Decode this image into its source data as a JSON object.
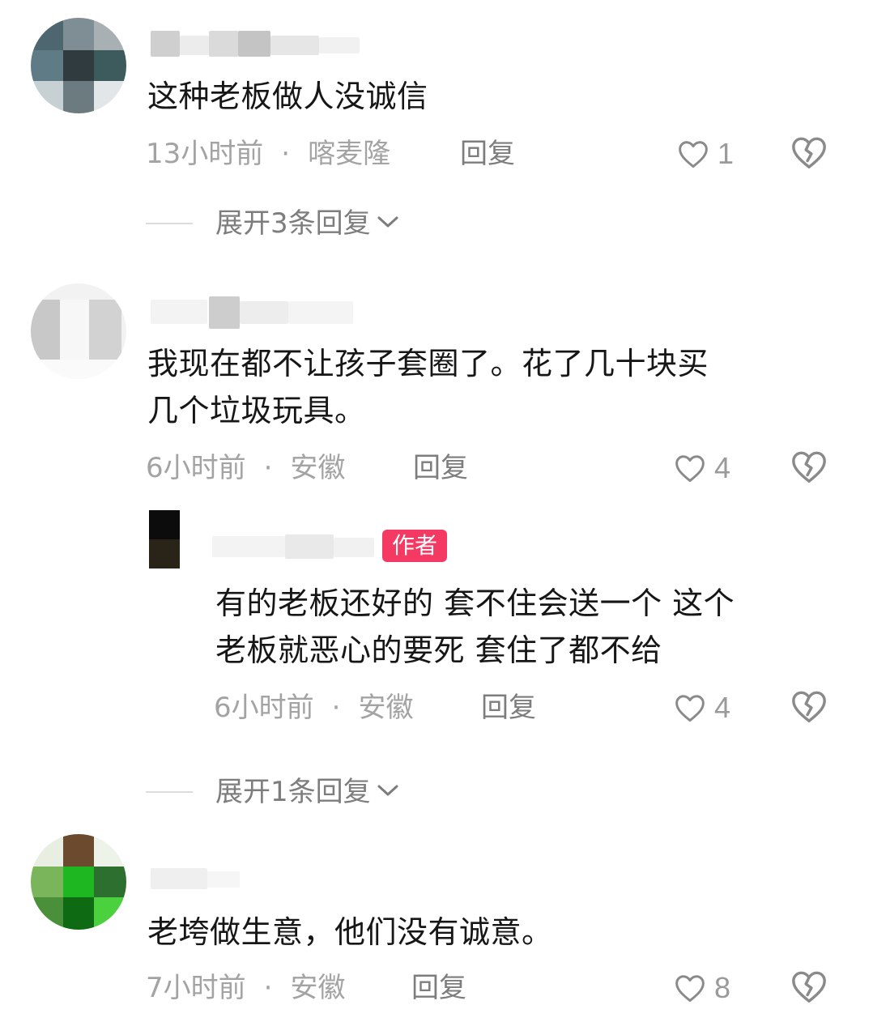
{
  "comments": [
    {
      "content_lines": [
        "这种老板做人没诚信"
      ],
      "time": "13小时前",
      "location": "喀麦隆",
      "reply_label": "回复",
      "likes": "1",
      "expand_label": "展开3条回复"
    },
    {
      "content_lines": [
        "我现在都不让孩子套圈了。花了几十块买",
        "几个垃圾玩具。"
      ],
      "time": "6小时前",
      "location": "安徽",
      "reply_label": "回复",
      "likes": "4",
      "reply": {
        "badge": "作者",
        "content_lines": [
          "有的老板还好的 套不住会送一个 这个",
          "老板就恶心的要死 套住了都不给"
        ],
        "time": "6小时前",
        "location": "安徽",
        "reply_label": "回复",
        "likes": "4"
      },
      "expand_label": "展开1条回复"
    },
    {
      "content_lines": [
        "老垮做生意，他们没有诚意。"
      ],
      "time": "7小时前",
      "location": "安徽",
      "reply_label": "回复",
      "likes": "8"
    }
  ],
  "separator": "·",
  "icons": {
    "like": "heart-outline-icon",
    "dislike": "broken-heart-icon",
    "expand": "chevron-down-icon"
  },
  "colors": {
    "author_badge": "#f43a63",
    "meta_text": "#a3a3a3",
    "body_text": "#161616"
  }
}
